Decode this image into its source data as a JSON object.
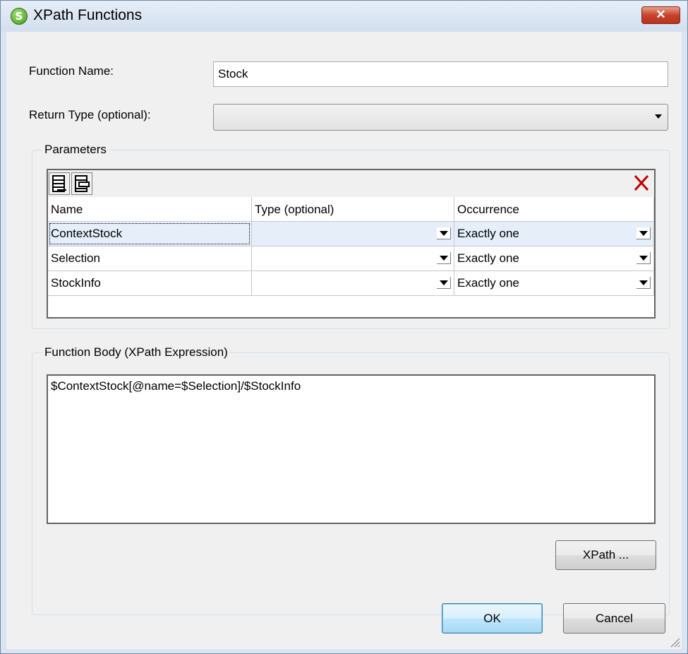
{
  "window": {
    "title": "XPath Functions",
    "icon_glyph": "S",
    "close_glyph": "✕"
  },
  "form": {
    "function_name_label": "Function Name:",
    "function_name_value": "Stock",
    "return_type_label": "Return Type (optional):",
    "return_type_value": ""
  },
  "parameters": {
    "group_label": "Parameters",
    "columns": [
      "Name",
      "Type (optional)",
      "Occurrence"
    ],
    "rows": [
      {
        "name": "ContextStock",
        "type": "",
        "occurrence": "Exactly one"
      },
      {
        "name": "Selection",
        "type": "",
        "occurrence": "Exactly one"
      },
      {
        "name": "StockInfo",
        "type": "",
        "occurrence": "Exactly one"
      }
    ],
    "toolbar_icons": [
      "append-row-icon",
      "insert-row-icon",
      "delete-row-icon"
    ]
  },
  "body": {
    "group_label": "Function Body (XPath Expression)",
    "expression": "$ContextStock[@name=$Selection]/$StockInfo",
    "xpath_button": "XPath ..."
  },
  "buttons": {
    "ok": "OK",
    "cancel": "Cancel"
  },
  "colors": {
    "close_button": "#c9432a",
    "app_icon": "#3f9a17",
    "delete_icon": "#c00000",
    "selected_row": "#e5eef9"
  }
}
